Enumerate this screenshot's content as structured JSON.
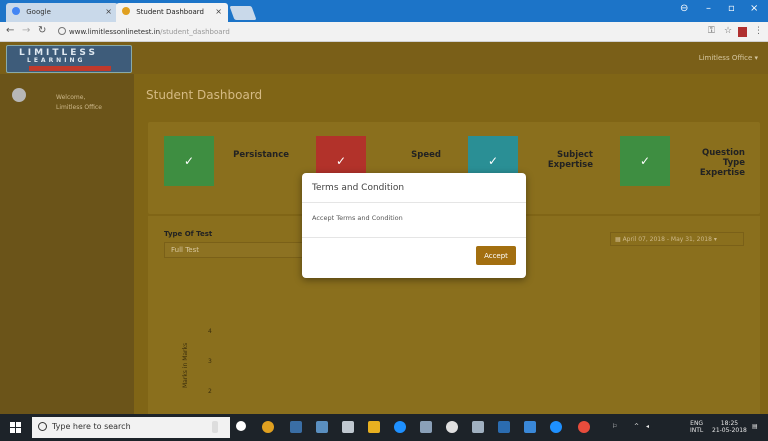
{
  "browser": {
    "tabs": [
      {
        "title": "Google",
        "active": false
      },
      {
        "title": "Student Dashboard",
        "active": true
      }
    ],
    "url_host": "www.limitlessonlinetest.in",
    "url_path": "/student_dashboard"
  },
  "app": {
    "logo_line1": "LIMITLESS",
    "logo_line2": "LEARNING",
    "user_menu": "Limitless Office ▾"
  },
  "sidebar": {
    "welcome": "Welcome,",
    "username": "Limitless Office"
  },
  "main": {
    "page_title": "Student Dashboard",
    "cards": [
      {
        "label": "Persistance",
        "color": "#3e8e41"
      },
      {
        "label": "Speed",
        "color": "#b2322a"
      },
      {
        "label": "Subject Expertise",
        "color": "#2a8f95"
      },
      {
        "label": "Question Type Expertise",
        "color": "#3e8e41"
      }
    ],
    "filter": {
      "label": "Type Of Test",
      "value": "Full Test",
      "date_range": "April 07, 2018 - May 31, 2018"
    },
    "chart": {
      "y_ticks": [
        "4",
        "3",
        "2"
      ],
      "y_label": "Marks in Marks"
    }
  },
  "modal": {
    "title": "Terms and Condition",
    "body": "Accept Terms and Condition",
    "accept_label": "Accept"
  },
  "taskbar": {
    "search_placeholder": "Type here to search",
    "lang": "ENG",
    "region": "INTL",
    "time": "18:25",
    "date": "21-05-2018"
  }
}
